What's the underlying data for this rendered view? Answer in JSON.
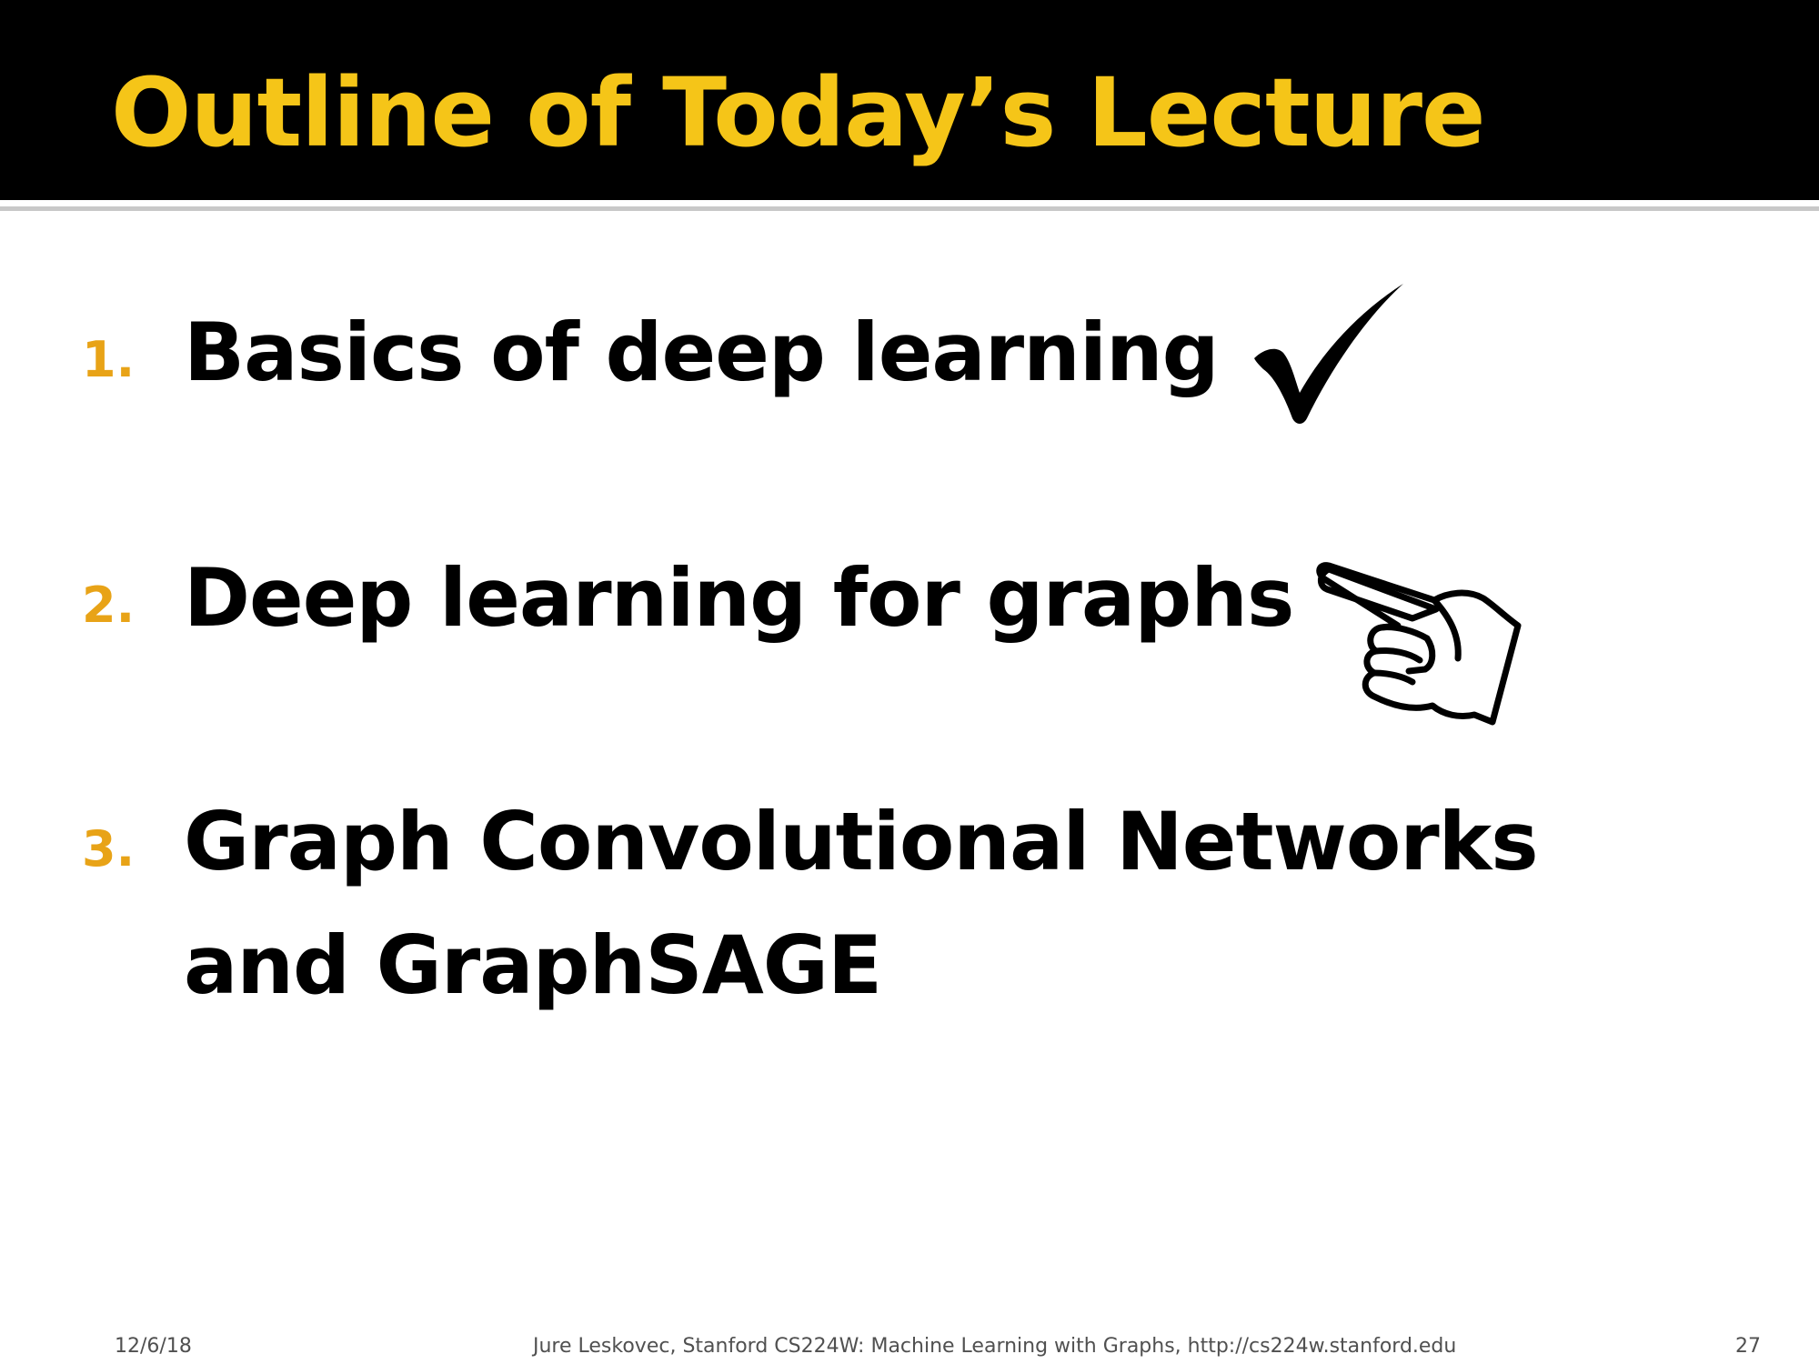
{
  "slide": {
    "title": "Outline of  Today’s Lecture",
    "items": [
      {
        "number": "1.",
        "text": "Basics of deep learning",
        "status_icon": "checkmark-icon"
      },
      {
        "number": "2.",
        "text": "Deep learning for graphs",
        "status_icon": "pointing-hand-icon"
      },
      {
        "number": "3.",
        "text": "Graph Convolutional Networks and GraphSAGE"
      }
    ],
    "footer": {
      "date": "12/6/18",
      "credit": "Jure Leskovec, Stanford CS224W: Machine Learning with Graphs, http://cs224w.stanford.edu",
      "page_number": "27"
    }
  },
  "colors": {
    "title_bar": "#000000",
    "title_text": "#f5c518",
    "item_number": "#e8a317",
    "body_text": "#000000",
    "footer_text": "#505050"
  }
}
